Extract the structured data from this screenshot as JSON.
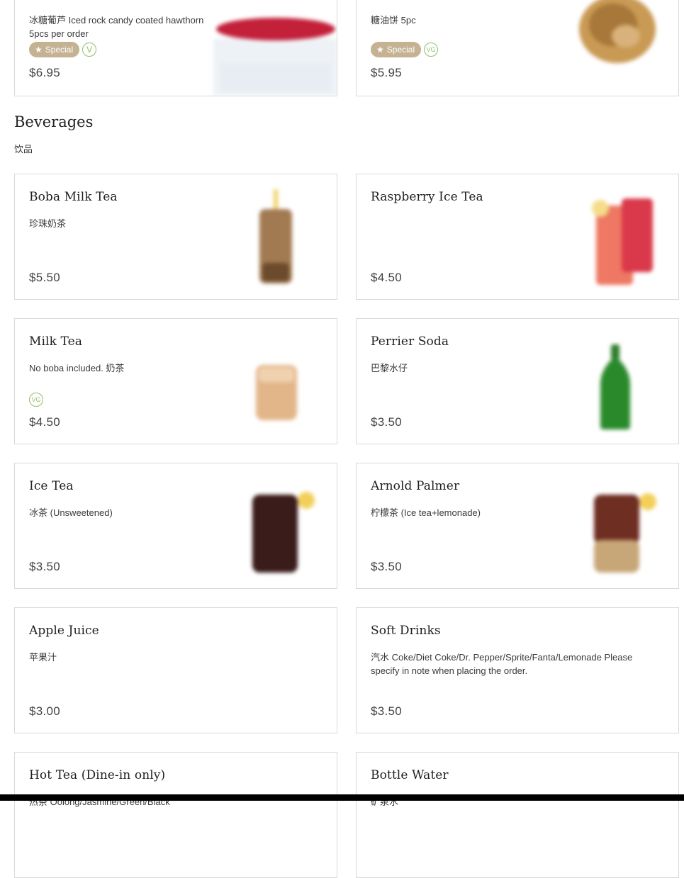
{
  "top_items": [
    {
      "desc": "冰糖葡芦 Iced rock candy coated hawthorn 5pcs per order",
      "special_label": "Special",
      "diet_tag": "V",
      "price": "$6.95"
    },
    {
      "desc": "糖油饼 5pc",
      "special_label": "Special",
      "diet_tag": "VG",
      "price": "$5.95"
    }
  ],
  "section": {
    "title": "Beverages",
    "subtitle": "饮品"
  },
  "items": [
    {
      "name": "Boba Milk Tea",
      "desc": "珍珠奶茶",
      "price": "$5.50"
    },
    {
      "name": "Raspberry Ice Tea",
      "desc": "",
      "price": "$4.50"
    },
    {
      "name": "Milk Tea",
      "desc": "No boba included. 奶茶",
      "diet_tag": "VG",
      "price": "$4.50"
    },
    {
      "name": "Perrier Soda",
      "desc": "巴黎水仔",
      "price": "$3.50"
    },
    {
      "name": "Ice Tea",
      "desc": "冰茶 (Unsweetened)",
      "price": "$3.50"
    },
    {
      "name": "Arnold Palmer",
      "desc": "柠檬茶 (Ice tea+lemonade)",
      "price": "$3.50"
    },
    {
      "name": "Apple Juice",
      "desc": "苹果汁",
      "price": "$3.00"
    },
    {
      "name": "Soft Drinks",
      "desc": "汽水 Coke/Diet Coke/Dr. Pepper/Sprite/Fanta/Lemonade Please specify in note when placing the order.",
      "price": "$3.50"
    },
    {
      "name": "Hot Tea (Dine-in only)",
      "desc": "热茶 Oolong/Jasmine/Green/Black"
    },
    {
      "name": "Bottle Water",
      "desc": "矿泉水"
    }
  ],
  "colors": {
    "special_badge": "#c4b293",
    "diet_tag": "#8fbf6a",
    "card_border": "#d9d9d9"
  },
  "icons": {
    "special": "star-icon"
  }
}
